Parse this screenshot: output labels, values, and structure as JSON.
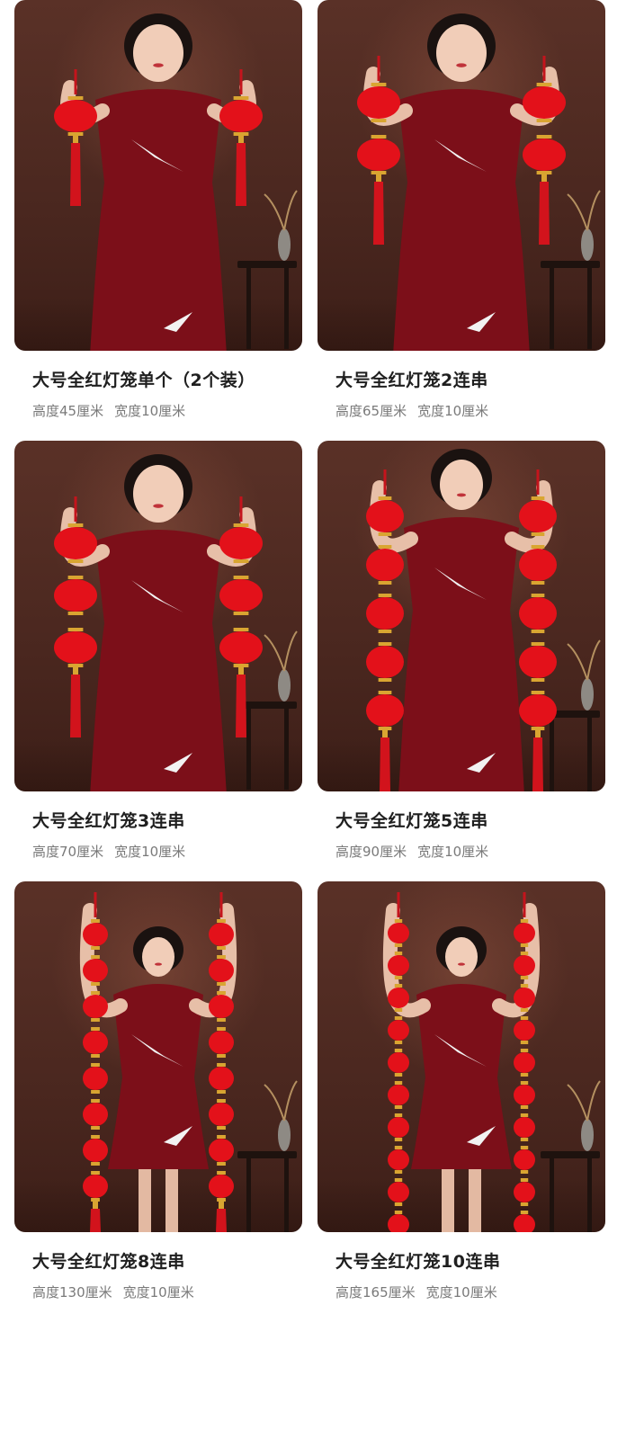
{
  "colors": {
    "background": "#ffffff",
    "photo_bg": "#4f2a21",
    "lantern": "#e3111a",
    "dress": "#7c0f19",
    "title": "#1f1f1f",
    "specs": "#7a7a7a"
  },
  "products": [
    {
      "title": "大号全红灯笼单个（2个装）",
      "height": "高度45厘米",
      "width": "宽度10厘米",
      "lantern_count": 1
    },
    {
      "title": "大号全红灯笼2连串",
      "height": "高度65厘米",
      "width": "宽度10厘米",
      "lantern_count": 2
    },
    {
      "title": "大号全红灯笼3连串",
      "height": "高度70厘米",
      "width": "宽度10厘米",
      "lantern_count": 3
    },
    {
      "title": "大号全红灯笼5连串",
      "height": "高度90厘米",
      "width": "宽度10厘米",
      "lantern_count": 5
    },
    {
      "title": "大号全红灯笼8连串",
      "height": "高度130厘米",
      "width": "宽度10厘米",
      "lantern_count": 8
    },
    {
      "title": "大号全红灯笼10连串",
      "height": "高度165厘米",
      "width": "宽度10厘米",
      "lantern_count": 10
    }
  ]
}
